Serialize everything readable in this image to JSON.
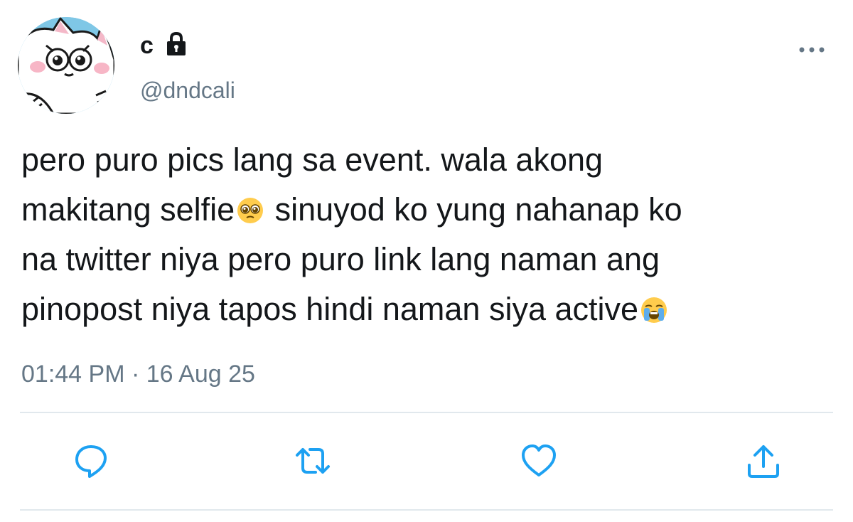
{
  "author": {
    "display_name": "c",
    "handle": "@dndcali",
    "protected_icon": "lock-icon",
    "avatar": "cat-avatar"
  },
  "tweet": {
    "lines": [
      "pero puro pics lang sa event. wala akong",
      "makitang selfie",
      " sinuyod ko yung nahanap ko",
      "na twitter niya pero puro link lang naman ang",
      "pinopost niya tapos hindi naman siya active"
    ],
    "emojis": [
      "pleading-face-emoji",
      "loudly-crying-face-emoji"
    ]
  },
  "meta": {
    "time": "01:44 PM",
    "separator": " · ",
    "date": "16 Aug 25"
  },
  "actions": [
    "reply-icon",
    "retweet-icon",
    "like-icon",
    "share-icon"
  ],
  "colors": {
    "text": "#14171a",
    "secondary": "#657786",
    "icon": "#1da1f2",
    "divider": "#e1e8ed"
  }
}
